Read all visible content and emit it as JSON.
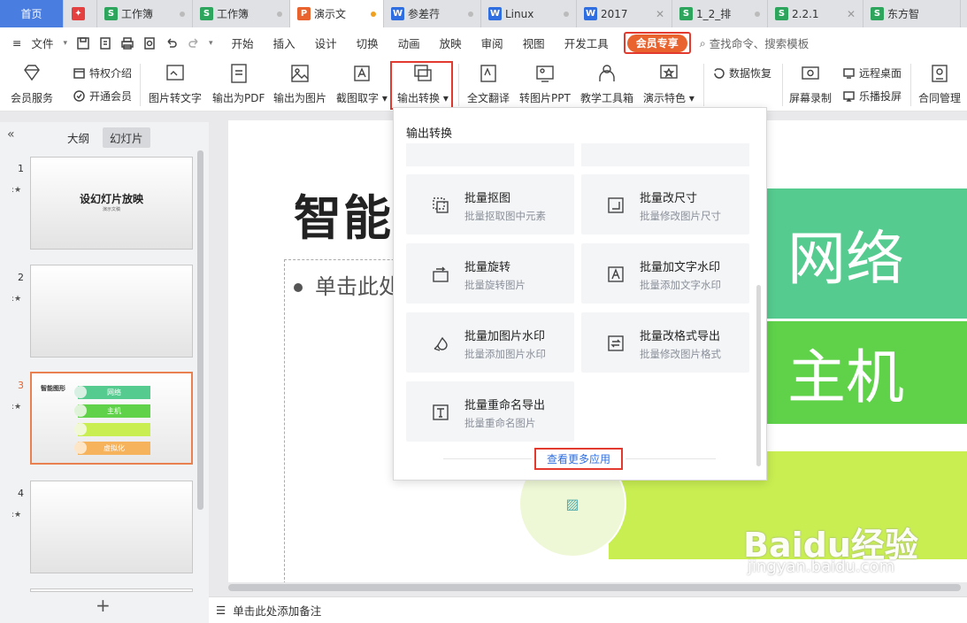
{
  "tabs": [
    {
      "label": "首页",
      "type": "home"
    },
    {
      "label": "",
      "type": "icon",
      "icon": "wps-logo-icon"
    },
    {
      "label": "工作簿",
      "badge": "S"
    },
    {
      "label": "工作簿",
      "badge": "S"
    },
    {
      "label": "演示文",
      "badge": "P",
      "active": true
    },
    {
      "label": "参差荇",
      "badge": "W"
    },
    {
      "label": "Linux",
      "badge": "W"
    },
    {
      "label": "2017",
      "badge": "W"
    },
    {
      "label": "1_2_排",
      "badge": "S"
    },
    {
      "label": "2.2.1",
      "badge": "S"
    },
    {
      "label": "东方智",
      "badge": "S"
    }
  ],
  "menubar": {
    "file": "文件",
    "items": [
      "开始",
      "插入",
      "设计",
      "切换",
      "动画",
      "放映",
      "审阅",
      "视图",
      "开发工具"
    ],
    "vip": "会员专享",
    "search": "查找命令、搜索模板"
  },
  "ribbon": {
    "member_service": "会员服务",
    "privilege": "特权介绍",
    "open_member": "开通会员",
    "pic_to_text": "图片转文字",
    "export_pdf": "输出为PDF",
    "export_pic": "输出为图片",
    "screenshot": "截图取字",
    "export_convert": "输出转换",
    "translate": "全文翻译",
    "pic_to_ppt": "转图片PPT",
    "teach_tools": "教学工具箱",
    "present_feature": "演示特色",
    "data_recover": "数据恢复",
    "screen_record": "屏幕录制",
    "remote_desktop": "远程桌面",
    "cast": "乐播投屏",
    "contract": "合同管理"
  },
  "left_pane": {
    "tab_outline": "大纲",
    "tab_slides": "幻灯片",
    "slides": [
      {
        "num": "1",
        "title": "设幻灯片放映",
        "sub": "演示文稿"
      },
      {
        "num": "2"
      },
      {
        "num": "3",
        "title": "智能图形",
        "items": [
          "网络",
          "主机",
          "",
          "虚拟化"
        ]
      },
      {
        "num": "4"
      }
    ]
  },
  "slide": {
    "title": "智能图",
    "bullet": "单击此处",
    "bar1": "网络",
    "bar2": "主机"
  },
  "notes": "单击此处添加备注",
  "popup": {
    "title": "输出转换",
    "cards": [
      {
        "t1": "批量抠图",
        "t2": "批量抠取图中元素",
        "icon": "cutout-icon"
      },
      {
        "t1": "批量改尺寸",
        "t2": "批量修改图片尺寸",
        "icon": "resize-icon"
      },
      {
        "t1": "批量旋转",
        "t2": "批量旋转图片",
        "icon": "rotate-icon"
      },
      {
        "t1": "批量加文字水印",
        "t2": "批量添加文字水印",
        "icon": "text-watermark-icon"
      },
      {
        "t1": "批量加图片水印",
        "t2": "批量添加图片水印",
        "icon": "image-watermark-icon"
      },
      {
        "t1": "批量改格式导出",
        "t2": "批量修改图片格式",
        "icon": "format-icon"
      },
      {
        "t1": "批量重命名导出",
        "t2": "批量重命名图片",
        "icon": "rename-icon"
      }
    ],
    "more": "查看更多应用"
  },
  "watermark": {
    "brand": "Baidu经验",
    "url": "jingyan.baidu.com"
  }
}
